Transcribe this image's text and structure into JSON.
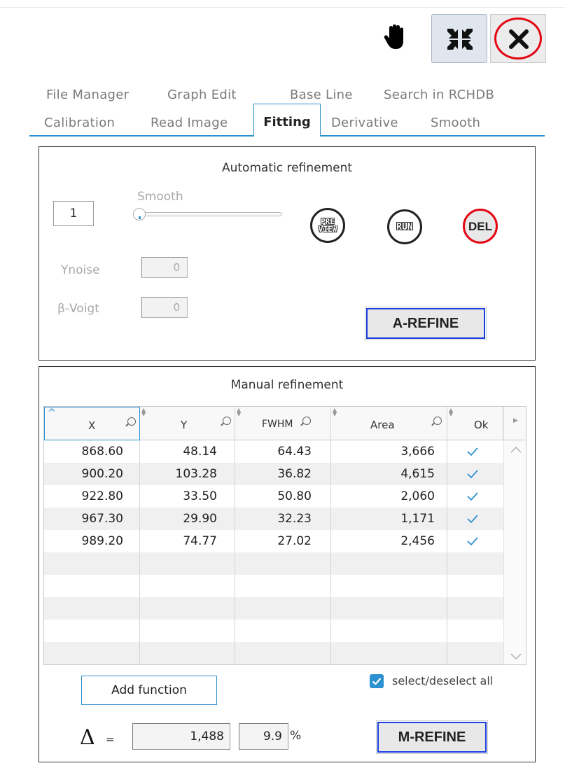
{
  "toolbar": {
    "hand_icon": "hand-pan-icon",
    "collapse_icon": "collapse-arrows-icon",
    "close_icon": "close-x-icon",
    "close_color": "#e30613"
  },
  "tabs": {
    "row1": [
      "File Manager",
      "Graph Edit",
      "Base Line",
      "Search in RCHDB"
    ],
    "row2": [
      "Calibration",
      "Read Image",
      "Fitting",
      "Derivative",
      "Smooth"
    ],
    "active": "Fitting",
    "accent": "#2b91d0"
  },
  "auto": {
    "title": "Automatic refinement",
    "count": "1",
    "smooth_label": "Smooth",
    "smooth_level": 0,
    "preview": {
      "line1": "PRE",
      "line2": "VIEW"
    },
    "run": "RUN",
    "del": "DEL",
    "ynoise_label": "Ynoise",
    "ynoise_value": "0",
    "voigt_label": "β-Voigt",
    "voigt_value": "0",
    "arefine": "A-REFINE"
  },
  "manual": {
    "title": "Manual refinement",
    "columns": [
      "X",
      "Y",
      "FWHM",
      "Area",
      "Ok"
    ],
    "rows": [
      {
        "x": "868.60",
        "y": "48.14",
        "fwhm": "64.43",
        "area": "3,666",
        "ok": true
      },
      {
        "x": "900.20",
        "y": "103.28",
        "fwhm": "36.82",
        "area": "4,615",
        "ok": true
      },
      {
        "x": "922.80",
        "y": "33.50",
        "fwhm": "50.80",
        "area": "2,060",
        "ok": true
      },
      {
        "x": "967.30",
        "y": "29.90",
        "fwhm": "32.23",
        "area": "1,171",
        "ok": true
      },
      {
        "x": "989.20",
        "y": "74.77",
        "fwhm": "27.02",
        "area": "2,456",
        "ok": true
      }
    ],
    "add_function": "Add function",
    "select_all": "select/deselect all",
    "delta_symbol": "Δ",
    "equals": "=",
    "delta_value": "1,488",
    "delta_percent": "9.9",
    "percent_sign": "%",
    "mrefine": "M-REFINE"
  }
}
